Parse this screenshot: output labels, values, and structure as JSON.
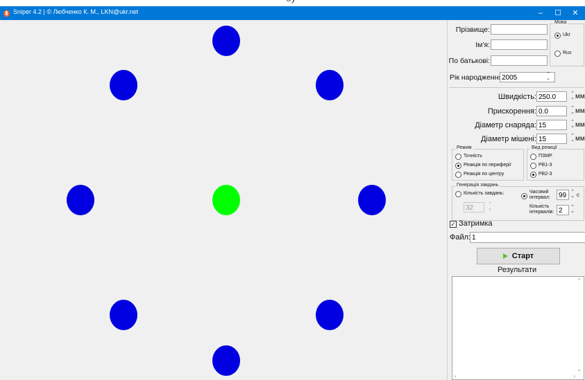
{
  "caption": "б)",
  "window": {
    "title": "Sniper 4.2 | © Любченко К. М., LKN@ukr.net",
    "minimize": "–",
    "maximize": "☐",
    "close": "✕",
    "accent": "#0078d7"
  },
  "canvas": {
    "target_color": "#0000e0",
    "active_color": "#00ff00"
  },
  "form": {
    "surname_label": "Прізвище:",
    "surname_value": "",
    "name_label": "Ім'я:",
    "name_value": "",
    "patronymic_label": "По батькові:",
    "patronymic_value": "",
    "birth_year_label": "Рік народження:",
    "birth_year_value": "2005",
    "language": {
      "title": "Мова",
      "options": [
        "Ukr",
        "Rus"
      ],
      "selected": "Ukr"
    },
    "speed_label": "Швидкість:",
    "speed_value": "250.0",
    "speed_unit": "мм/с",
    "accel_label": "Прискорення:",
    "accel_value": "0.0",
    "accel_unit": "мм/с",
    "projectile_label": "Діаметр снаряда:",
    "projectile_value": "15",
    "projectile_unit": "мм",
    "target_label": "Діаметр мішені:",
    "target_value": "15",
    "target_unit": "мм",
    "mode": {
      "title": "Режим",
      "options": [
        "Точність",
        "Реакція по периферії",
        "Реакція по центру"
      ],
      "selected": "Реакція по периферії"
    },
    "reaction_type": {
      "title": "Вид реакції",
      "options": [
        "ПЗМР",
        "РВ1-3",
        "РВ2-3"
      ],
      "selected": "РВ2-3"
    },
    "generation": {
      "title": "Генерація завдань",
      "count_option": "Кількість завдань:",
      "count_value": "32",
      "time_option": "Часовий інтервал:",
      "time_value": "99",
      "time_unit": "с",
      "intervals_label": "Кількість інтервалів:",
      "intervals_value": "2",
      "selected": "time"
    },
    "delay_label": "Затримка",
    "delay_checked": true,
    "file_label": "Файл:",
    "file_value": "1",
    "start_label": "Старт",
    "results_label": "Результати"
  }
}
